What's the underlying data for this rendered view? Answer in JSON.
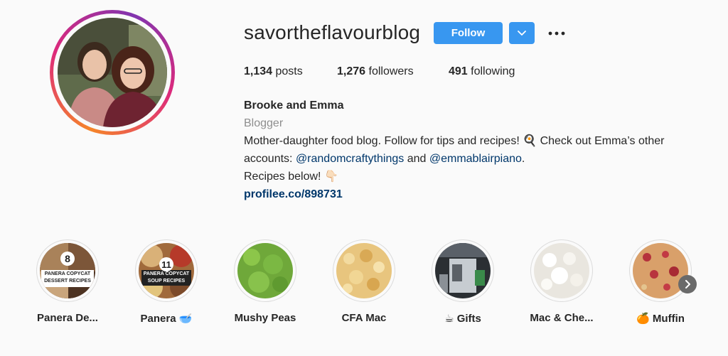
{
  "profile": {
    "username": "savortheflavourblog",
    "follow_label": "Follow",
    "stats": {
      "posts_count": "1,134",
      "posts_label": "posts",
      "followers_count": "1,276",
      "followers_label": "followers",
      "following_count": "491",
      "following_label": "following"
    },
    "bio": {
      "name": "Brooke and Emma",
      "category": "Blogger",
      "line1": "Mother-daughter food blog. Follow for tips and recipes! 🍳 Check out Emma’s other",
      "line2_prefix": "accounts: ",
      "mention1": "@randomcraftythings",
      "line2_mid": " and ",
      "mention2": "@emmablairpiano",
      "line2_suffix": ".",
      "line3": "Recipes below! 👇🏻",
      "link": "profilee.co/898731"
    }
  },
  "highlights": [
    {
      "label": "Panera De...",
      "badge": "8",
      "caption": "PANERA COPYCAT DESSERT RECIPES"
    },
    {
      "label": "Panera 🥣",
      "badge": "11",
      "caption": "PANERA COPYCAT SOUP RECIPES"
    },
    {
      "label": "Mushy Peas"
    },
    {
      "label": "CFA Mac"
    },
    {
      "label": "☕ Gifts"
    },
    {
      "label": "Mac & Che..."
    },
    {
      "label": "🍊 Muffin"
    }
  ],
  "colors": {
    "accent": "#3897f0",
    "link": "#00376b",
    "muted": "#8e8e8e"
  }
}
